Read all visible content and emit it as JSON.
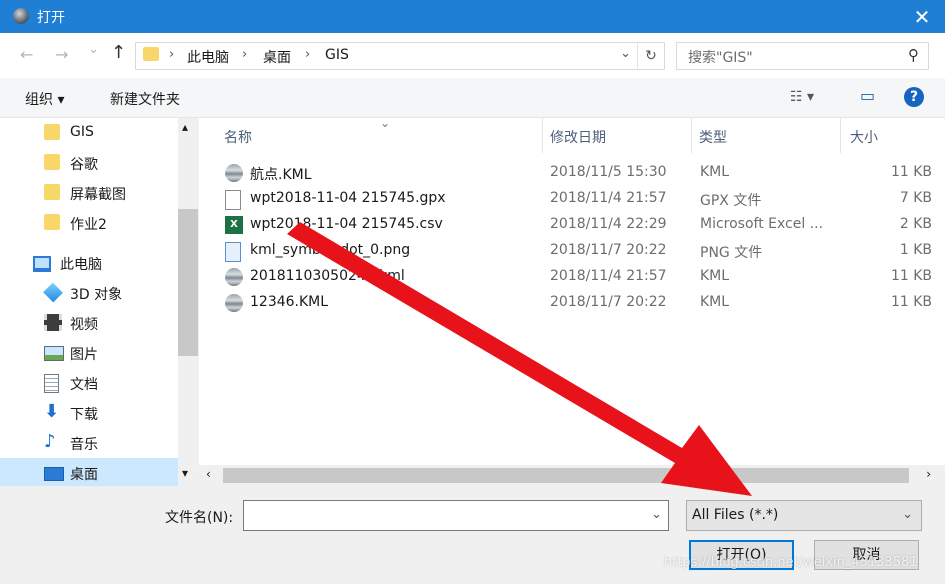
{
  "window": {
    "title": "打开",
    "close": "✕"
  },
  "nav_buttons": {
    "back": "←",
    "forward": "→",
    "recent": "⌄",
    "up": "↑"
  },
  "address": {
    "crumbs": [
      "此电脑",
      "桌面",
      "GIS"
    ],
    "separator": "›",
    "dropdown": "⌄",
    "refresh": "↻"
  },
  "search": {
    "placeholder": "搜索\"GIS\"",
    "icon": "search-icon"
  },
  "toolbar": {
    "organize": "组织 ▾",
    "new_folder": "新建文件夹",
    "view": "☷ ▾",
    "preview_pane": "▭",
    "help": "?"
  },
  "sidebar": {
    "items": [
      {
        "label": "GIS",
        "icon": "folder-icon"
      },
      {
        "label": "谷歌",
        "icon": "folder-icon"
      },
      {
        "label": "屏幕截图",
        "icon": "folder-icon"
      },
      {
        "label": "作业2",
        "icon": "folder-icon"
      },
      {
        "label": "此电脑",
        "icon": "computer-icon"
      },
      {
        "label": "3D 对象",
        "icon": "3d-objects-icon"
      },
      {
        "label": "视频",
        "icon": "video-icon"
      },
      {
        "label": "图片",
        "icon": "pictures-icon"
      },
      {
        "label": "文档",
        "icon": "documents-icon"
      },
      {
        "label": "下载",
        "icon": "download-icon"
      },
      {
        "label": "音乐",
        "icon": "music-icon"
      },
      {
        "label": "桌面",
        "icon": "desktop-icon",
        "selected": true
      }
    ]
  },
  "columns": {
    "name": "名称",
    "date": "修改日期",
    "type": "类型",
    "size": "大小",
    "sort_indicator": "⌄"
  },
  "files": [
    {
      "name": "航点.KML",
      "date": "2018/11/5 15:30",
      "type": "KML",
      "size": "11 KB",
      "icon": "kml-icon"
    },
    {
      "name": "wpt2018-11-04 215745.gpx",
      "date": "2018/11/4 21:57",
      "type": "GPX 文件",
      "size": "7 KB",
      "icon": "file-icon"
    },
    {
      "name": "wpt2018-11-04 215745.csv",
      "date": "2018/11/4 22:29",
      "type": "Microsoft Excel ...",
      "size": "2 KB",
      "icon": "excel-icon"
    },
    {
      "name": "kml_symbol_dot_0.png",
      "date": "2018/11/7 20:22",
      "type": "PNG 文件",
      "size": "1 KB",
      "icon": "image-icon"
    },
    {
      "name": "20181103050245.kml",
      "date": "2018/11/4 21:57",
      "type": "KML",
      "size": "11 KB",
      "icon": "kml-icon"
    },
    {
      "name": "12346.KML",
      "date": "2018/11/7 20:22",
      "type": "KML",
      "size": "11 KB",
      "icon": "kml-icon"
    }
  ],
  "scroll": {
    "up": "▴",
    "down": "▾",
    "left": "‹",
    "right": "›"
  },
  "footer": {
    "filename_label": "文件名(N):",
    "filename_value": "",
    "filetype": "All Files (*.*)",
    "dropdown": "⌄",
    "open_button": "打开(O)",
    "cancel_button": "取消"
  },
  "watermark": "https://blog.csdn.net/weixin_43133581",
  "colors": {
    "titlebar": "#1f7fd4",
    "selection": "#cce8ff",
    "arrow": "#e8121a",
    "primary_border": "#0078d7"
  }
}
